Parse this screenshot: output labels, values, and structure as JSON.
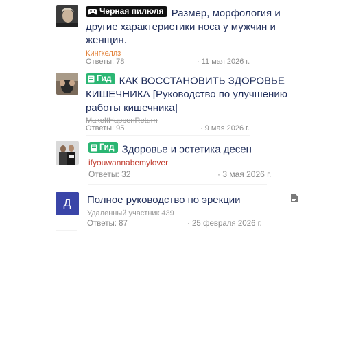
{
  "threads": [
    {
      "badge": "Черная пилюля",
      "badge_icon": "gamepad-icon",
      "title": "Размер, морфология и другие характеристики носа у мужчин и женщин.",
      "author": "Кингкеллз",
      "replies": "Ответы: 78",
      "date": "· 11 мая 2026 г."
    },
    {
      "badge": "Гид",
      "badge_icon": "book-icon",
      "title": "КАК ВОССТАНОВИТЬ ЗДОРОВЬЕ КИШЕЧНИКА [Руководство по улучшению работы кишечника]",
      "author": "MakeItHappenReturn",
      "replies": "Ответы: 95",
      "date": "· 9 мая 2026 г."
    },
    {
      "badge": "Гид",
      "badge_icon": "book-icon",
      "title": "Здоровье и эстетика десен",
      "author": "ifyouwannabemylover",
      "replies": "Ответы: 32",
      "date": "· 3 мая 2026 г."
    },
    {
      "avatar_letter": "Д",
      "title": "Полное руководство по эрекции",
      "author": "Удаленный участник 439",
      "replies": "Ответы: 87",
      "date": "· 25 февраля 2026 г.",
      "status_icon": "document-icon"
    }
  ],
  "colors": {
    "title": "#1f2d5a",
    "guide_badge": "#2bb673",
    "blackpill_badge": "#111111",
    "author_orange": "#e07b30",
    "author_red": "#c0392b",
    "letter_avatar": "#3a45a8"
  }
}
